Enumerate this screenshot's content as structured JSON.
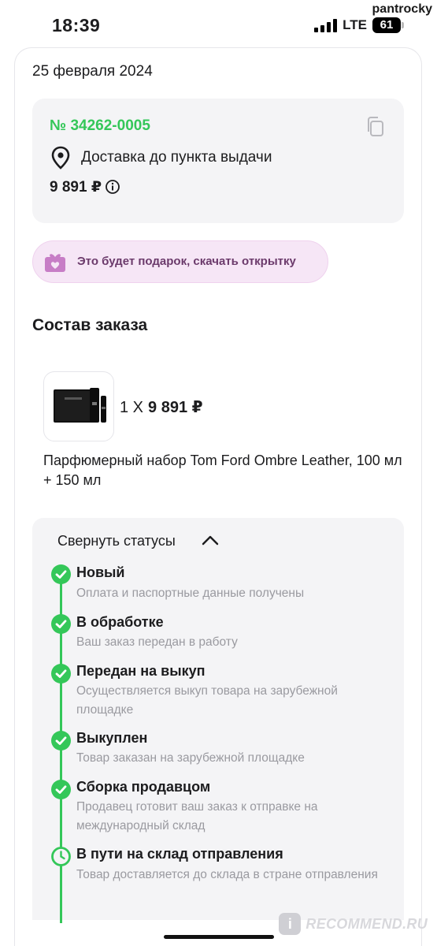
{
  "status_bar": {
    "time": "18:39",
    "network": "LTE",
    "battery": "61",
    "watermark": "pantrocky"
  },
  "order": {
    "date": "25 февраля 2024",
    "number": "№ 34262-0005",
    "delivery": "Доставка до пункта выдачи",
    "price": "9 891 ₽",
    "icons": {
      "copy": "copy-icon",
      "location": "location-pin-icon",
      "info": "info-icon"
    }
  },
  "gift": {
    "label": "Это будет подарок, скачать открытку",
    "icon": "gift-card-icon"
  },
  "composition": {
    "title": "Состав заказа",
    "items": [
      {
        "quantity": "1 Х",
        "price": "9 891 ₽",
        "name": "Парфюмерный набор Tom Ford Ombre Leather, 100 мл + 150 мл"
      }
    ]
  },
  "statuses": {
    "toggle_label": "Свернуть статусы",
    "items": [
      {
        "title": "Новый",
        "desc": "Оплата и паспортные данные получены",
        "state": "done"
      },
      {
        "title": "В обработке",
        "desc": "Ваш заказ передан в работу",
        "state": "done"
      },
      {
        "title": "Передан на выкуп",
        "desc": "Осуществляется выкуп товара на зарубежной площадке",
        "state": "done"
      },
      {
        "title": "Выкуплен",
        "desc": "Товар заказан на зарубежной площадке",
        "state": "done"
      },
      {
        "title": "Сборка продавцом",
        "desc": "Продавец готовит ваш заказ к отправке на международный склад",
        "state": "done"
      },
      {
        "title": "В пути на склад отправления",
        "desc": "Товар доставляется до склада в стране отправления",
        "state": "in-progress"
      }
    ]
  },
  "colors": {
    "accent_green": "#34c759",
    "gift_bg": "#f6e6f6",
    "gift_text": "#6b3a6b",
    "card_bg": "#f4f4f6",
    "muted_text": "#9a9aa0"
  },
  "watermark": {
    "badge": "i",
    "text": "RECOMMEND.RU"
  }
}
